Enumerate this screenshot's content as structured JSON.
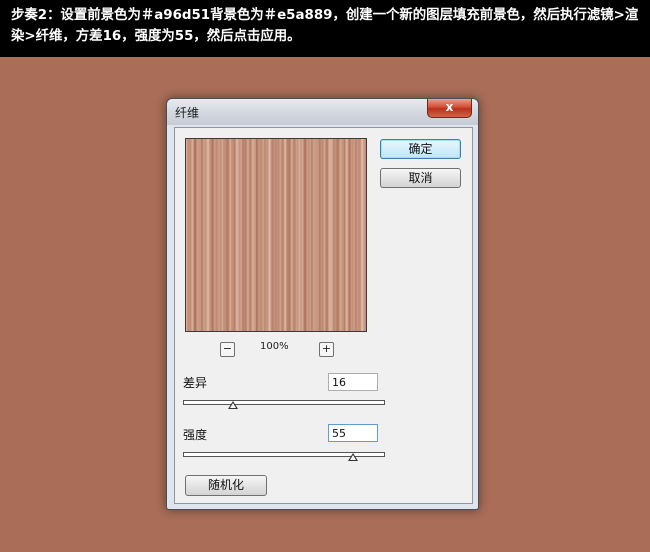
{
  "instruction": {
    "text": "步奏2：设置前景色为＃a96d51背景色为＃e5a889，创建一个新的图层填充前景色，然后执行滤镜>渲染>纤维，方差16，强度为55，然后点击应用。"
  },
  "dialog": {
    "title": "纤维",
    "close_label": "x",
    "ok_label": "确定",
    "cancel_label": "取消",
    "zoom_out_label": "−",
    "zoom_in_label": "+",
    "zoom_level": "100%",
    "variance_label": "差异",
    "variance_value": "16",
    "variance_fraction": 0.25,
    "strength_label": "强度",
    "strength_value": "55",
    "strength_fraction": 0.85,
    "randomize_label": "随机化"
  },
  "colors": {
    "page_background": "#a96d58",
    "foreground_color": "#a96d51",
    "background_color": "#e5a889",
    "ok_button_border": "#3c7fb1",
    "close_button": "#d0472f"
  },
  "icons": {
    "close": "close-icon",
    "zoom_out": "minus-icon",
    "zoom_in": "plus-icon"
  }
}
